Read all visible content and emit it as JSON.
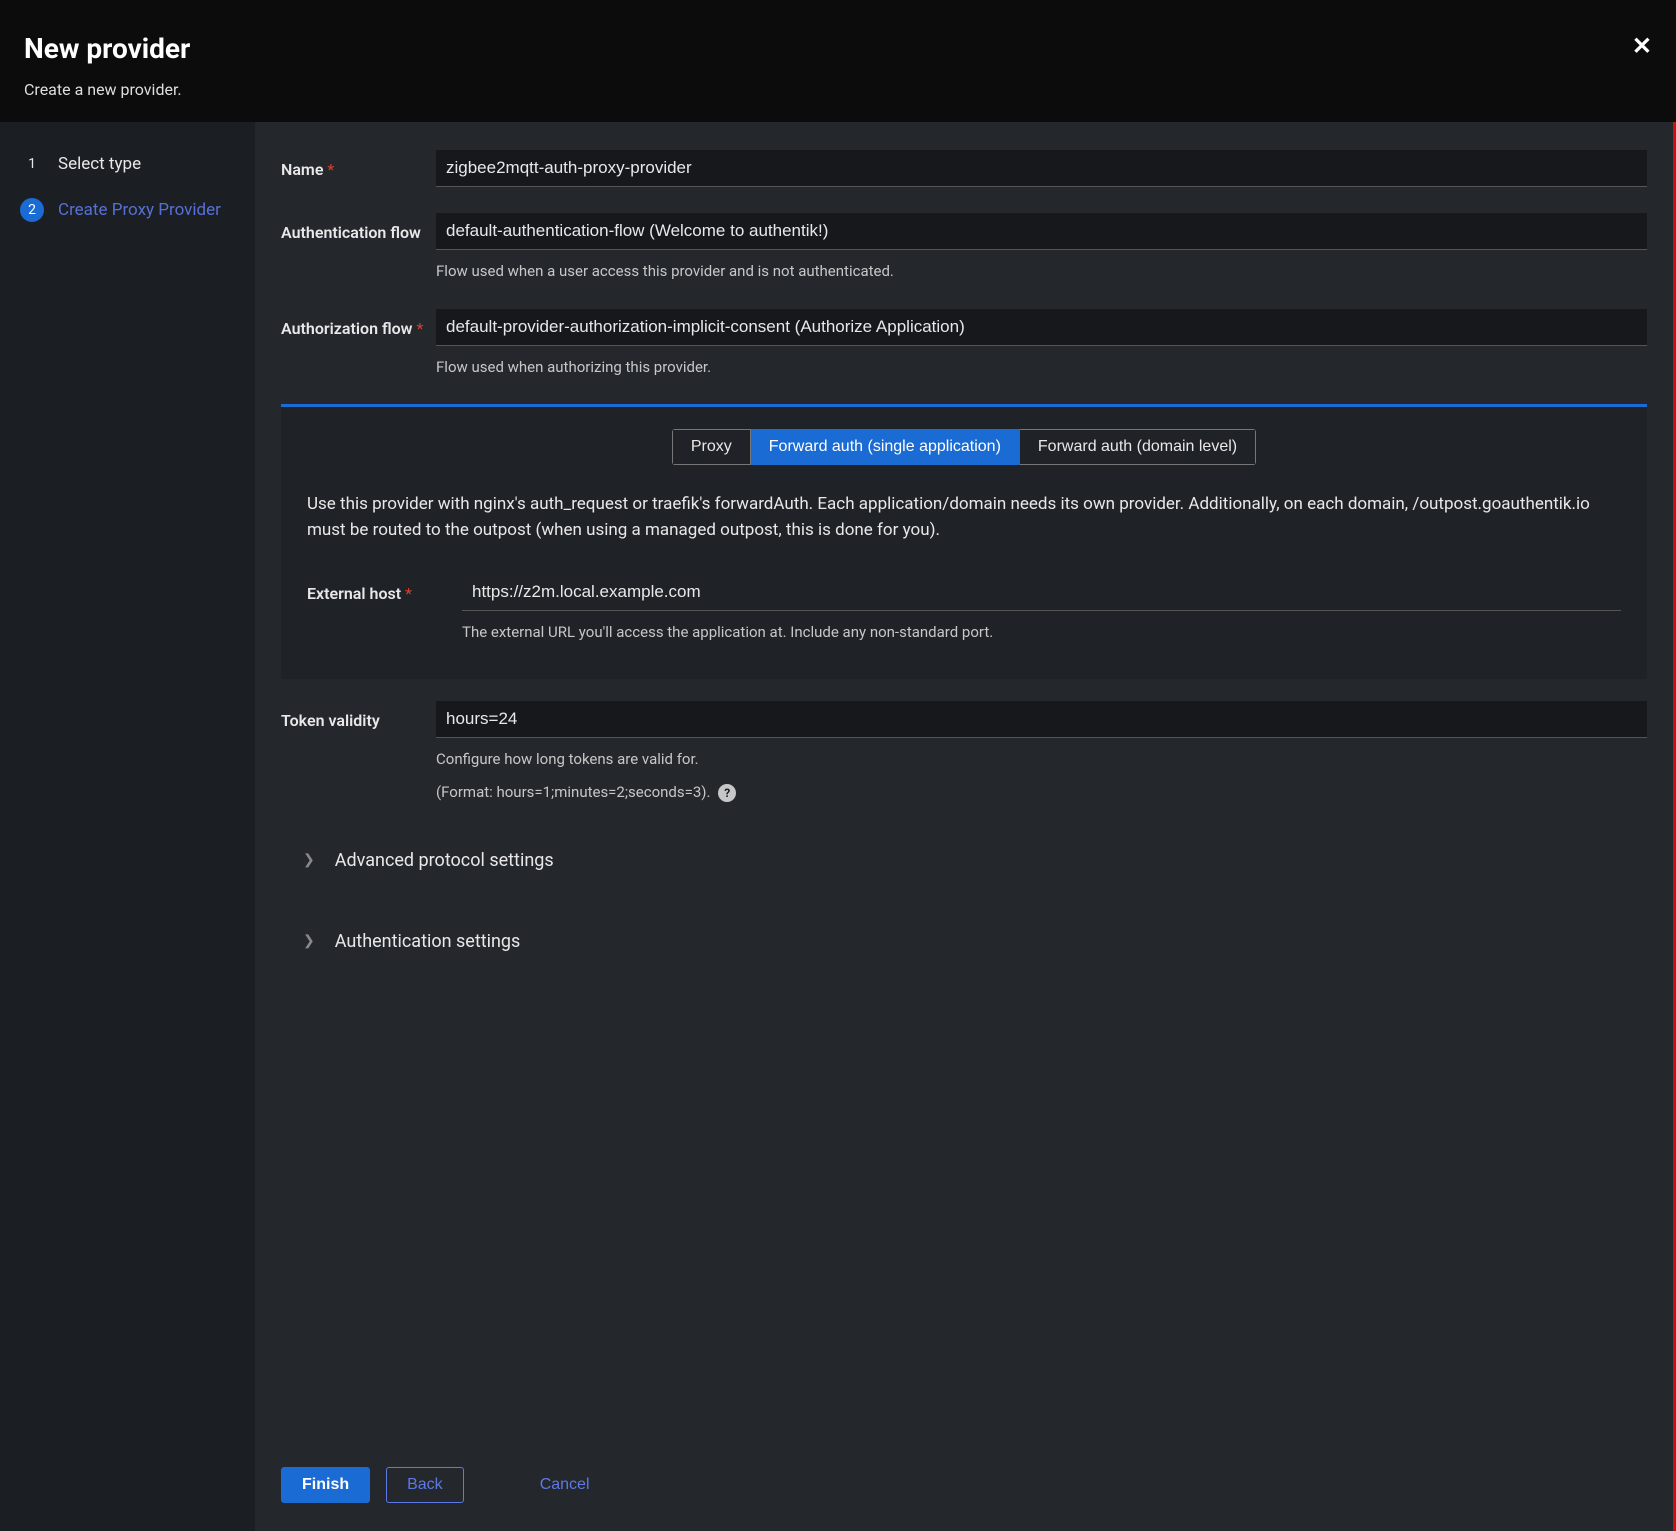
{
  "header": {
    "title": "New provider",
    "subtitle": "Create a new provider."
  },
  "steps": {
    "s1": {
      "num": "1",
      "label": "Select type"
    },
    "s2": {
      "num": "2",
      "label": "Create Proxy Provider"
    }
  },
  "form": {
    "name": {
      "label": "Name",
      "value": "zigbee2mqtt-auth-proxy-provider"
    },
    "auth_flow": {
      "label": "Authentication flow",
      "value": "default-authentication-flow (Welcome to authentik!)",
      "help": "Flow used when a user access this provider and is not authenticated."
    },
    "authz_flow": {
      "label": "Authorization flow",
      "value": "default-provider-authorization-implicit-consent (Authorize Application)",
      "help": "Flow used when authorizing this provider."
    },
    "tabs": {
      "proxy": "Proxy",
      "fwd_single": "Forward auth (single application)",
      "fwd_domain": "Forward auth (domain level)"
    },
    "fwd_desc": "Use this provider with nginx's auth_request or traefik's forwardAuth. Each application/domain needs its own provider. Additionally, on each domain, /outpost.goauthentik.io must be routed to the outpost (when using a managed outpost, this is done for you).",
    "external_host": {
      "label": "External host",
      "value": "https://z2m.local.example.com",
      "help": "The external URL you'll access the application at. Include any non-standard port."
    },
    "token_validity": {
      "label": "Token validity",
      "value": "hours=24",
      "help1": "Configure how long tokens are valid for.",
      "help2": "(Format: hours=1;minutes=2;seconds=3)."
    },
    "adv_protocol": "Advanced protocol settings",
    "auth_settings": "Authentication settings"
  },
  "footer": {
    "finish": "Finish",
    "back": "Back",
    "cancel": "Cancel"
  }
}
